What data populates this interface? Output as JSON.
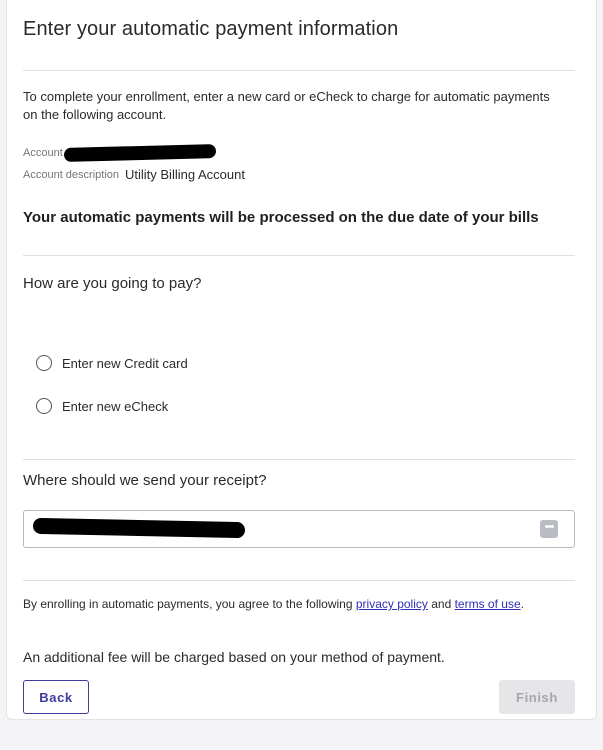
{
  "header": {
    "title": "Enter your automatic payment information"
  },
  "intro": {
    "text": "To complete your enrollment, enter a new card or eCheck to charge for automatic payments on the following account."
  },
  "account": {
    "label": "Account",
    "value_redacted": true,
    "description_label": "Account description",
    "description_value": "Utility Billing Account"
  },
  "notice": "Your automatic payments will be processed on the due date of your bills",
  "payment": {
    "question": "How are you going to pay?",
    "options": [
      {
        "label": "Enter new Credit card",
        "selected": false
      },
      {
        "label": "Enter new eCheck",
        "selected": false
      }
    ]
  },
  "receipt": {
    "question": "Where should we send your receipt?",
    "value_redacted": true,
    "picker_icon": "more-options-icon"
  },
  "agreement": {
    "prefix": "By enrolling in automatic payments, you agree to the following ",
    "privacy_link": "privacy policy",
    "connector": " and ",
    "terms_link": "terms of use",
    "suffix": "."
  },
  "fee_notice": "An additional fee will be charged based on your method of payment.",
  "actions": {
    "back_label": "Back",
    "finish_label": "Finish",
    "finish_disabled": true
  },
  "colors": {
    "accent": "#3e3c9e",
    "link": "#2f2fb8",
    "disabled_bg": "#e6e6e8"
  }
}
